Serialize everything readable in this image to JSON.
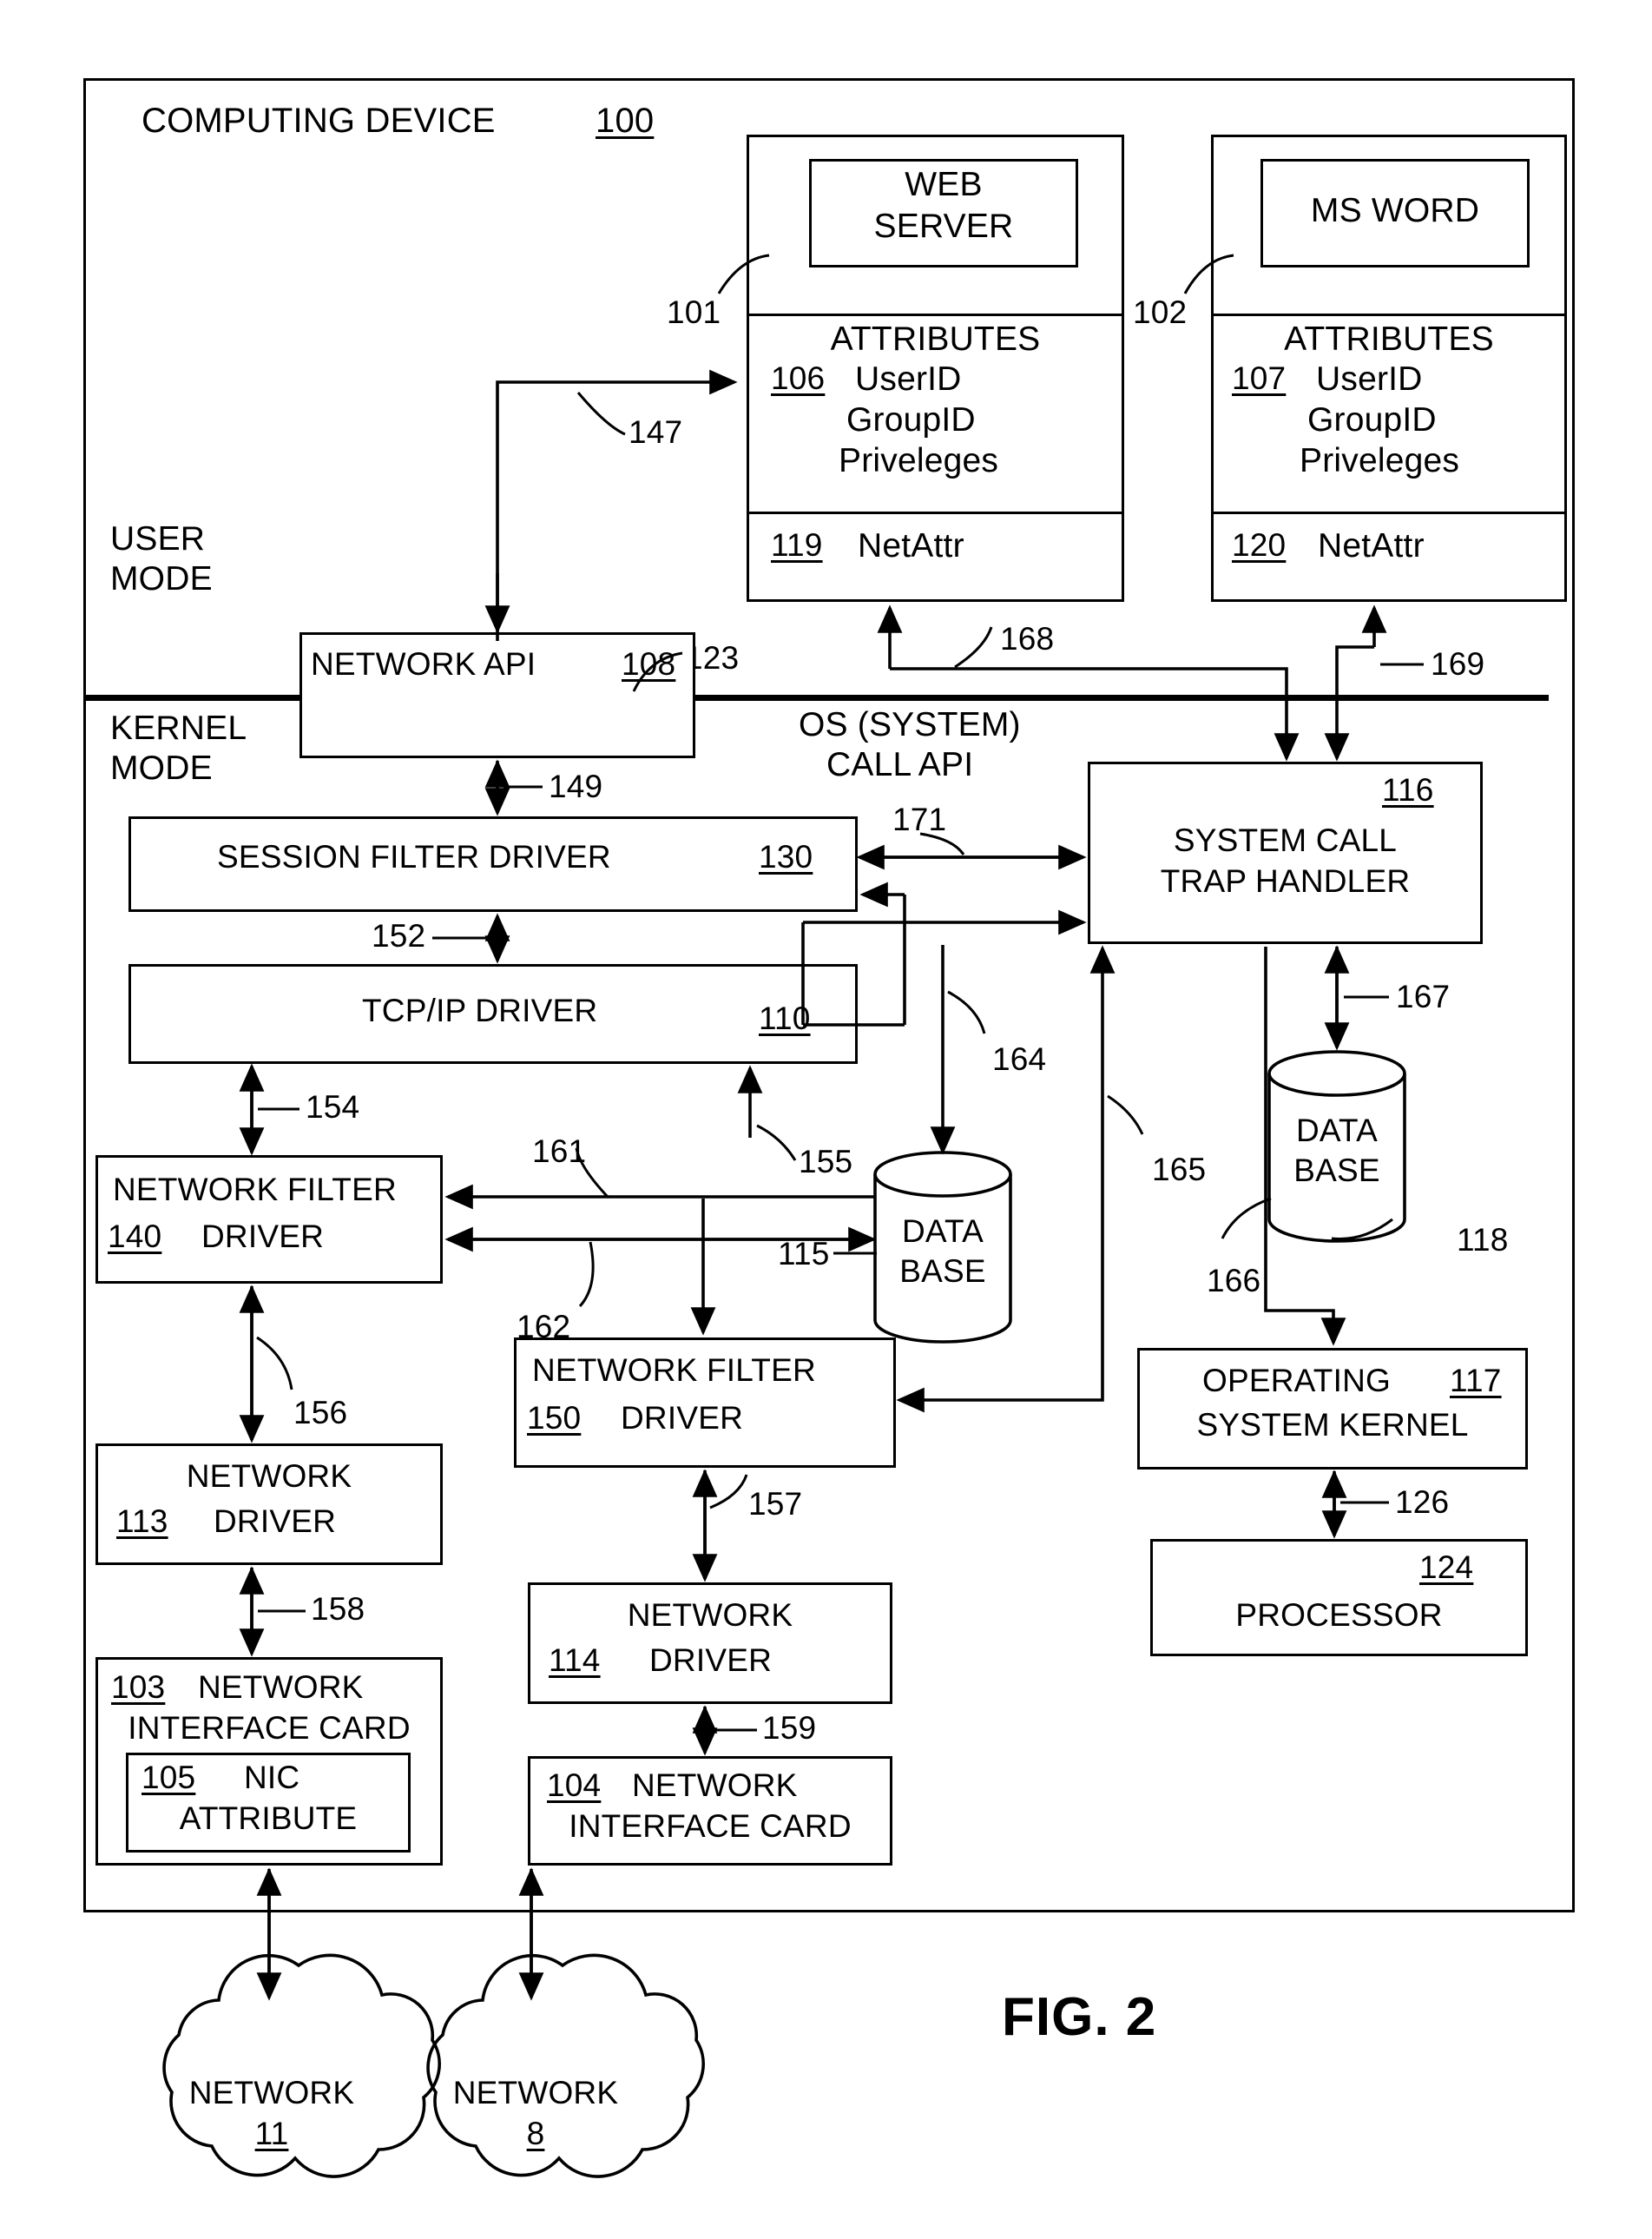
{
  "figure": {
    "label": "FIG. 2",
    "outer_container_title": "COMPUTING DEVICE",
    "outer_container_ref": "100"
  },
  "mode_labels": {
    "user_mode_line1": "USER",
    "user_mode_line2": "MODE",
    "kernel_mode_line1": "KERNEL",
    "kernel_mode_line2": "MODE",
    "os_call_api_line1": "OS (SYSTEM)",
    "os_call_api_line2": "CALL API",
    "os_call_api_ref": "123"
  },
  "applications": [
    {
      "name": "app-web-server",
      "app_title_line1": "WEB",
      "app_title_line2": "SERVER",
      "app_ref": "101",
      "attributes_header": "ATTRIBUTES",
      "attributes_ref": "106",
      "attributes": [
        "UserID",
        "GroupID",
        "Priveleges"
      ],
      "netattr_ref": "119",
      "netattr_label": "NetAttr"
    },
    {
      "name": "app-ms-word",
      "app_title_line1": "MS WORD",
      "app_title_line2": "",
      "app_ref": "102",
      "attributes_header": "ATTRIBUTES",
      "attributes_ref": "107",
      "attributes": [
        "UserID",
        "GroupID",
        "Priveleges"
      ],
      "netattr_ref": "120",
      "netattr_label": "NetAttr"
    }
  ],
  "blocks": {
    "network_api": {
      "label": "NETWORK API",
      "ref": "108"
    },
    "session_filter_driver": {
      "label": "SESSION FILTER DRIVER",
      "ref": "130"
    },
    "tcpip_driver": {
      "label": "TCP/IP DRIVER",
      "ref": "110"
    },
    "network_filter_driver_140": {
      "line1": "NETWORK FILTER",
      "line2": "DRIVER",
      "ref": "140"
    },
    "network_filter_driver_150": {
      "line1": "NETWORK FILTER",
      "line2": "DRIVER",
      "ref": "150"
    },
    "network_driver_113": {
      "line1": "NETWORK",
      "line2": "DRIVER",
      "ref": "113"
    },
    "network_driver_114": {
      "line1": "NETWORK",
      "line2": "DRIVER",
      "ref": "114"
    },
    "nic_103": {
      "line1": "NETWORK",
      "line2": "INTERFACE CARD",
      "ref": "103"
    },
    "nic_attribute_105": {
      "line1": "NIC",
      "line2": "ATTRIBUTE",
      "ref": "105"
    },
    "nic_104": {
      "line1": "NETWORK",
      "line2": "INTERFACE CARD",
      "ref": "104"
    },
    "system_call_trap_handler": {
      "line1": "SYSTEM CALL",
      "line2": "TRAP HANDLER",
      "ref": "116"
    },
    "operating_system_kernel": {
      "line1": "OPERATING",
      "line2": "SYSTEM KERNEL",
      "ref": "117"
    },
    "processor": {
      "label": "PROCESSOR",
      "ref": "124"
    },
    "database_115": {
      "line1": "DATA",
      "line2": "BASE",
      "ref": "115"
    },
    "database_118": {
      "line1": "DATA",
      "line2": "BASE",
      "ref": "118"
    }
  },
  "networks": [
    {
      "label": "NETWORK",
      "ref": "11"
    },
    {
      "label": "NETWORK",
      "ref": "8"
    }
  ],
  "connector_refs": {
    "c147": "147",
    "c149": "149",
    "c152": "152",
    "c154": "154",
    "c155": "155",
    "c156": "156",
    "c157": "157",
    "c158": "158",
    "c159": "159",
    "c161": "161",
    "c162": "162",
    "c164": "164",
    "c165": "165",
    "c166": "166",
    "c167": "167",
    "c168": "168",
    "c169": "169",
    "c171": "171",
    "c126": "126"
  },
  "colors": {
    "ink": "#000000",
    "paper": "#ffffff"
  }
}
